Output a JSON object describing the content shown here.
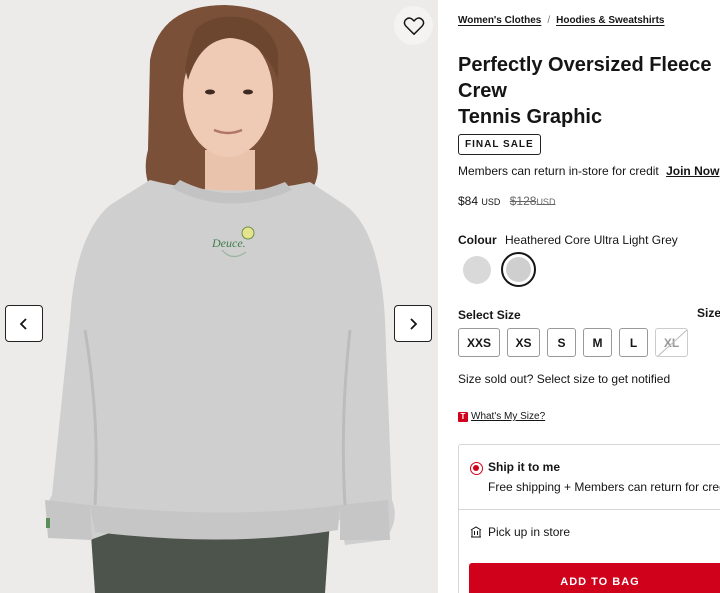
{
  "product_image": {
    "alt": "Perfectly Oversized Fleece Crew Tennis Graphic",
    "graphic_text": "Deuce."
  },
  "breadcrumb": {
    "items": [
      "Women's Clothes",
      "Hoodies & Sweatshirts"
    ],
    "separator": "/"
  },
  "product": {
    "title_line1": "Perfectly Oversized Fleece Crew",
    "title_line2": "Tennis Graphic",
    "badge": "FINAL SALE",
    "members_text": "Members can return in-store for credit",
    "join_label": "Join Now",
    "price": "$84",
    "price_currency": "USD",
    "original_price": "$128",
    "original_currency": "USD"
  },
  "colour": {
    "label": "Colour",
    "selected": "Heathered Core Ultra Light Grey",
    "swatches": [
      "#d9d9d9",
      "#cfcfcf"
    ]
  },
  "sizes": {
    "label": "Select Size",
    "guide_label": "Size",
    "options": [
      "XXS",
      "XS",
      "S",
      "M",
      "L",
      "XL"
    ],
    "unavailable": [
      "XL"
    ],
    "sold_out_text": "Size sold out? Select size to get notified",
    "whats_my_size": "What's My Size?"
  },
  "delivery": {
    "ship_title": "Ship it to me",
    "ship_sub": "Free shipping + Members can return for credit",
    "pickup": "Pick up in store"
  },
  "add_to_bag": "ADD TO BAG",
  "colors": {
    "accent": "#d0021b",
    "text": "#151515"
  }
}
